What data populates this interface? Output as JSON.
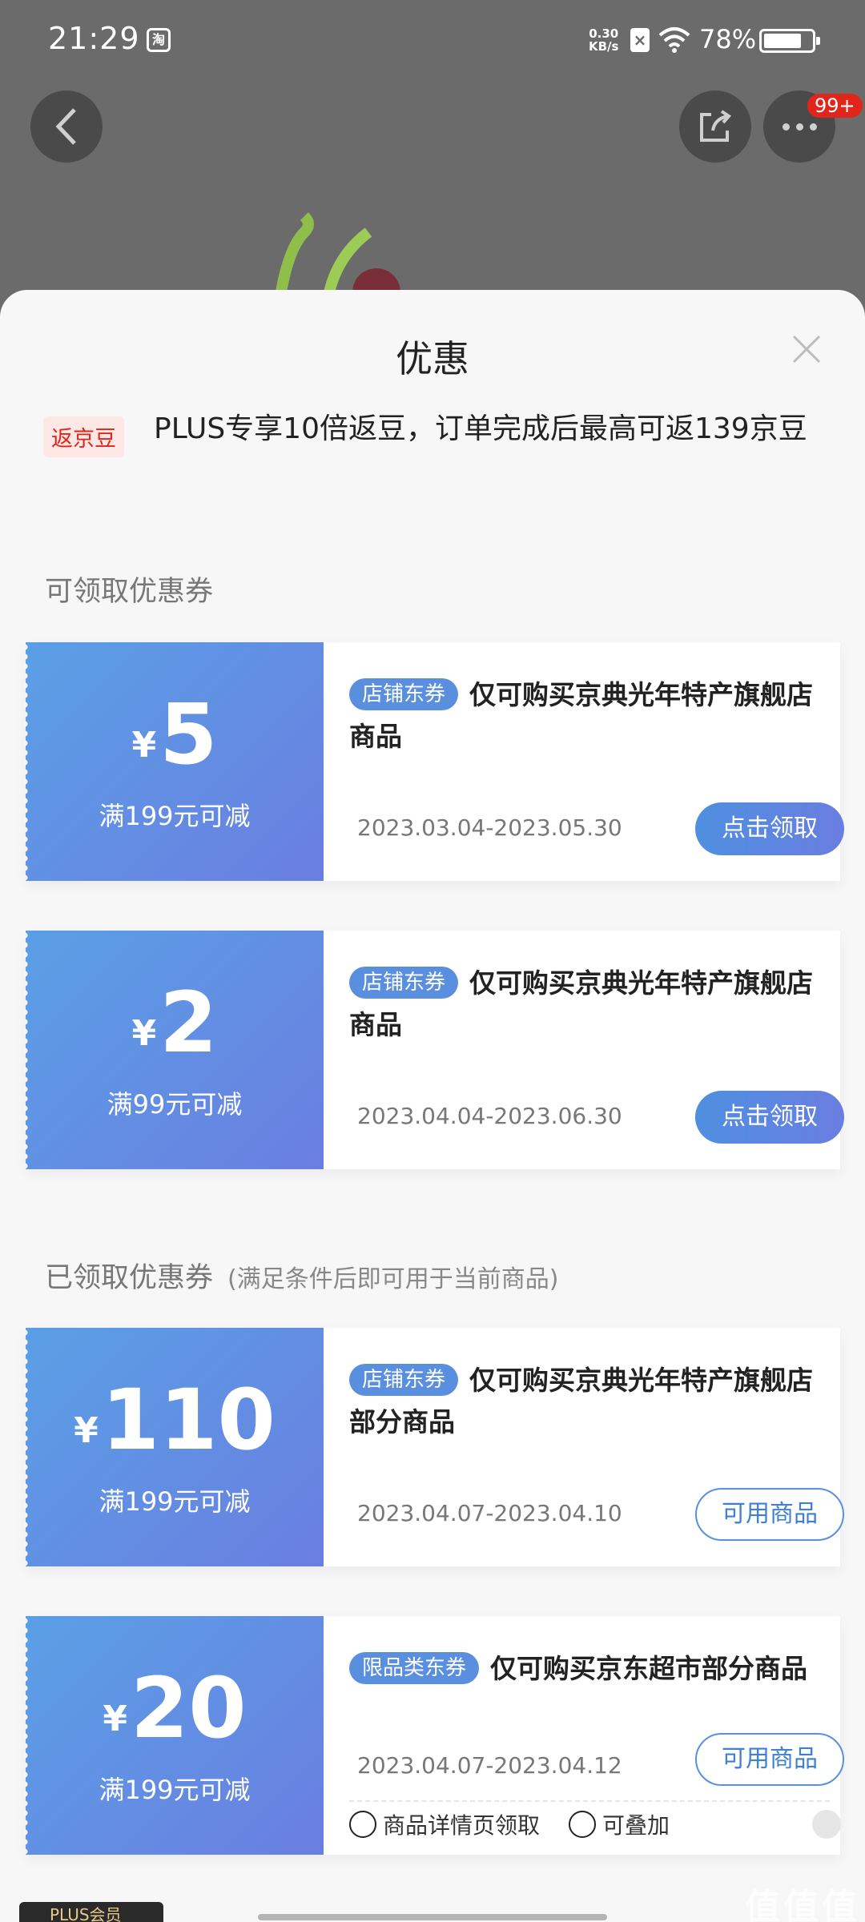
{
  "status_bar": {
    "time": "21:29",
    "app_icon_char": "淘",
    "net_speed": "0.30\nKB/s",
    "battery": "78%"
  },
  "nav": {
    "more_badge": "99+"
  },
  "sheet": {
    "title": "优惠",
    "rebate_tag": "返京豆",
    "rebate_text": "PLUS专享10倍返豆，订单完成后最高可返139京豆",
    "available_title": "可领取优惠券",
    "claimed_title": "已领取优惠券",
    "claimed_subtitle": "(满足条件后即可用于当前商品)"
  },
  "coupons": [
    {
      "currency": "¥",
      "amount": "5",
      "condition": "满199元可减",
      "tag": "店铺东券",
      "desc": "仅可购买京典光年特产旗舰店商品",
      "date": "2023.03.04-2023.05.30",
      "action": "点击领取"
    },
    {
      "currency": "¥",
      "amount": "2",
      "condition": "满99元可减",
      "tag": "店铺东券",
      "desc": "仅可购买京典光年特产旗舰店商品",
      "date": "2023.04.04-2023.06.30",
      "action": "点击领取"
    },
    {
      "currency": "¥",
      "amount": "110",
      "condition": "满199元可减",
      "tag": "店铺东券",
      "desc": "仅可购买京典光年特产旗舰店部分商品",
      "date": "2023.04.07-2023.04.10",
      "action": "可用商品"
    },
    {
      "currency": "¥",
      "amount": "20",
      "condition": "满199元可减",
      "tag": "限品类东券",
      "desc": "仅可购买京东超市部分商品",
      "date": "2023.04.07-2023.04.12",
      "action": "可用商品",
      "meta_1": "商品详情页领取",
      "meta_2": "可叠加"
    }
  ],
  "footer": {
    "plus_label": "PLUS会员",
    "watermark": "值值值",
    "watermark_url": "zhizhizhi.com"
  }
}
